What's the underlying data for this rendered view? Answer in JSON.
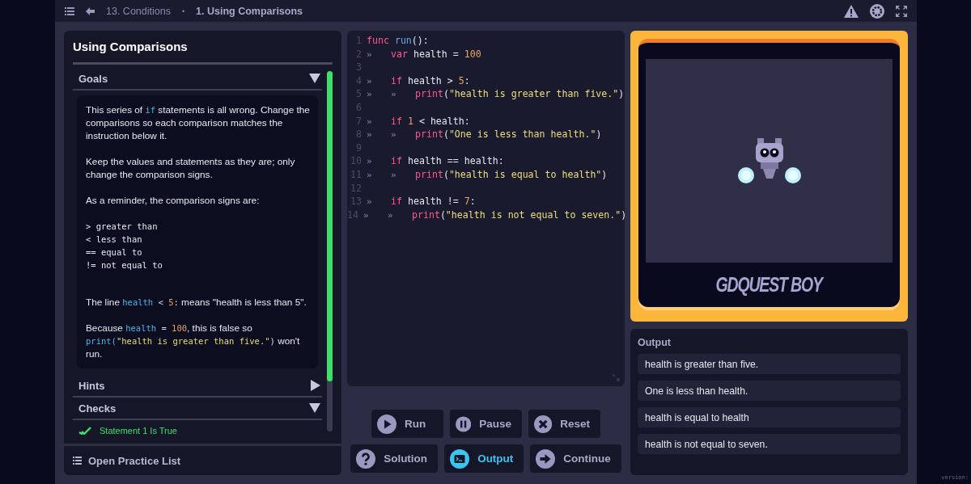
{
  "breadcrumb": {
    "course": "13. Conditions",
    "separator": "•",
    "lesson": "1. Using Comparisons"
  },
  "lesson": {
    "title": "Using Comparisons",
    "sections": [
      {
        "title": "Goals",
        "expanded": true,
        "paragraphs": [
          {
            "kind": "prose",
            "segments": [
              {
                "kind": "text",
                "text": "This series of "
              },
              {
                "kind": "code",
                "text": "if"
              },
              {
                "kind": "text",
                "text": " statements is all wrong. Change the comparisons so each comparison matches the instruction below it."
              }
            ]
          },
          {
            "kind": "prose",
            "segments": [
              {
                "kind": "text",
                "text": "Keep the values and statements as they are; only change the comparison signs."
              }
            ]
          },
          {
            "kind": "prose",
            "segments": [
              {
                "kind": "text",
                "text": "As a reminder, the comparison signs are:"
              }
            ]
          },
          {
            "kind": "listing",
            "lines": [
              "> greater than",
              "< less than",
              "== equal to",
              "!= not equal to"
            ]
          },
          {
            "kind": "prose",
            "segments": [
              {
                "kind": "text",
                "text": "The line "
              },
              {
                "kind": "code",
                "text": "health"
              },
              {
                "kind": "op",
                "text": " < "
              },
              {
                "kind": "number",
                "text": "5"
              },
              {
                "kind": "op",
                "text": ":"
              },
              {
                "kind": "text",
                "text": " means \"health is less than 5\"."
              }
            ]
          },
          {
            "kind": "prose",
            "segments": [
              {
                "kind": "text",
                "text": "Because "
              },
              {
                "kind": "code",
                "text": "health"
              },
              {
                "kind": "op",
                "text": " = "
              },
              {
                "kind": "number",
                "text": "100"
              },
              {
                "kind": "text",
                "text": ", this is false so "
              },
              {
                "kind": "code",
                "text": "print("
              },
              {
                "kind": "string",
                "text": "\"health is greater than five.\""
              },
              {
                "kind": "op",
                "text": ")"
              },
              {
                "kind": "text",
                "text": " won't run."
              }
            ]
          }
        ]
      },
      {
        "title": "Hints",
        "expanded": false
      },
      {
        "title": "Checks",
        "expanded": true,
        "items": [
          {
            "label": "Statement 1 Is True",
            "passed": true
          }
        ]
      }
    ],
    "practice_list": "Open Practice List"
  },
  "code": [
    {
      "number": "1",
      "tokens": [
        {
          "kind": "keyword",
          "text": "func "
        },
        {
          "kind": "func",
          "text": "run"
        },
        {
          "kind": "plain",
          "text": "():"
        }
      ]
    },
    {
      "number": "2",
      "tokens": [
        {
          "kind": "tab",
          "text": "»"
        },
        {
          "kind": "keyword",
          "text": "var"
        },
        {
          "kind": "plain",
          "text": " health = "
        },
        {
          "kind": "number",
          "text": "100"
        }
      ]
    },
    {
      "number": "3"
    },
    {
      "number": "4",
      "tokens": [
        {
          "kind": "tab",
          "text": "»"
        },
        {
          "kind": "keyword",
          "text": "if"
        },
        {
          "kind": "plain",
          "text": " health > "
        },
        {
          "kind": "number",
          "text": "5"
        },
        {
          "kind": "plain",
          "text": ":"
        }
      ]
    },
    {
      "number": "5",
      "tokens": [
        {
          "kind": "tab",
          "text": "»"
        },
        {
          "kind": "tab",
          "text": "»"
        },
        {
          "kind": "keyword",
          "text": "print"
        },
        {
          "kind": "plain",
          "text": "("
        },
        {
          "kind": "string",
          "text": "\"health is greater than five.\""
        },
        {
          "kind": "plain",
          "text": ")"
        }
      ]
    },
    {
      "number": "6"
    },
    {
      "number": "7",
      "tokens": [
        {
          "kind": "tab",
          "text": "»"
        },
        {
          "kind": "keyword",
          "text": "if "
        },
        {
          "kind": "number",
          "text": "1"
        },
        {
          "kind": "plain",
          "text": " < health:"
        }
      ]
    },
    {
      "number": "8",
      "tokens": [
        {
          "kind": "tab",
          "text": "»"
        },
        {
          "kind": "tab",
          "text": "»"
        },
        {
          "kind": "keyword",
          "text": "print"
        },
        {
          "kind": "plain",
          "text": "("
        },
        {
          "kind": "string",
          "text": "\"One is less than health.\""
        },
        {
          "kind": "plain",
          "text": ")"
        }
      ]
    },
    {
      "number": "9"
    },
    {
      "number": "10",
      "tokens": [
        {
          "kind": "tab",
          "text": "»"
        },
        {
          "kind": "keyword",
          "text": "if"
        },
        {
          "kind": "plain",
          "text": " health == health:"
        }
      ]
    },
    {
      "number": "11",
      "tokens": [
        {
          "kind": "tab",
          "text": "»"
        },
        {
          "kind": "tab",
          "text": "»"
        },
        {
          "kind": "keyword",
          "text": "print"
        },
        {
          "kind": "plain",
          "text": "("
        },
        {
          "kind": "string",
          "text": "\"health is equal to health\""
        },
        {
          "kind": "plain",
          "text": ")"
        }
      ]
    },
    {
      "number": "12"
    },
    {
      "number": "13",
      "tokens": [
        {
          "kind": "tab",
          "text": "»"
        },
        {
          "kind": "keyword",
          "text": "if"
        },
        {
          "kind": "plain",
          "text": " health != "
        },
        {
          "kind": "number",
          "text": "7"
        },
        {
          "kind": "plain",
          "text": ":"
        }
      ]
    },
    {
      "number": "14",
      "tokens": [
        {
          "kind": "tab",
          "text": "»"
        },
        {
          "kind": "tab",
          "text": "»"
        },
        {
          "kind": "keyword",
          "text": "print"
        },
        {
          "kind": "plain",
          "text": "("
        },
        {
          "kind": "string",
          "text": "\"health is not equal to seven.\""
        },
        {
          "kind": "plain",
          "text": ")"
        }
      ]
    }
  ],
  "buttons": [
    {
      "label": "Run",
      "kind": "run",
      "active": false
    },
    {
      "label": "Pause",
      "kind": "pause",
      "active": false
    },
    {
      "label": "Reset",
      "kind": "reset",
      "active": false
    },
    {
      "label": "Solution",
      "kind": "solution",
      "active": false
    },
    {
      "label": "Output",
      "kind": "output",
      "active": true
    },
    {
      "label": "Continue",
      "kind": "continue",
      "active": false
    }
  ],
  "game": {
    "console_name": "GDQUEST BOY"
  },
  "output": {
    "title": "Output",
    "lines": [
      "health is greater than five.",
      "One is less than health.",
      "health is equal to health",
      "health is not equal to seven."
    ]
  },
  "version_label": "version:"
}
